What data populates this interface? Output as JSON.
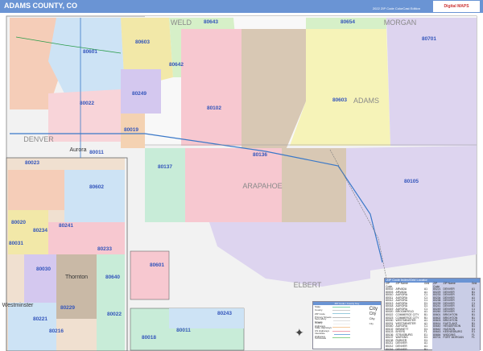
{
  "header": {
    "title": "ADAMS COUNTY, CO",
    "edition": "2022 ZIP Code ColorCast Edition",
    "logo": "Digital MAPS"
  },
  "counties": [
    "WELD",
    "MORGAN",
    "ADAMS",
    "ARAPAHOE",
    "ELBERT",
    "DENVER"
  ],
  "zip_labels": [
    "80643",
    "80654",
    "80701",
    "80603",
    "80601",
    "80642",
    "80249",
    "80022",
    "80102",
    "80603",
    "80019",
    "80011",
    "80136",
    "80023",
    "80137",
    "80602",
    "80105",
    "80020",
    "80241",
    "80234",
    "80031",
    "80233",
    "80601",
    "80640",
    "80030",
    "80229",
    "80221",
    "80216",
    "80022",
    "80243",
    "80011",
    "80018"
  ],
  "cities": [
    "Aurora",
    "Westminster",
    "Thornton"
  ],
  "zip_table": {
    "title": "ZIP Code Index/Grid Locator",
    "headers": [
      "ZIP Code",
      "ZIP Name",
      "Grid"
    ],
    "left": [
      [
        "80002",
        "ARVADA",
        "A1"
      ],
      [
        "80003",
        "ARVADA",
        "A1"
      ],
      [
        "80010",
        "AURORA",
        "C1"
      ],
      [
        "80011",
        "AURORA",
        "C1"
      ],
      [
        "80012",
        "AURORA",
        "C1"
      ],
      [
        "80013",
        "AURORA",
        "D1"
      ],
      [
        "80018",
        "AURORA",
        "D1"
      ],
      [
        "80019",
        "AURORA",
        "C1"
      ],
      [
        "80020",
        "BROOMFIELD",
        "A1"
      ],
      [
        "80022",
        "COMMERCE CITY",
        "B1"
      ],
      [
        "80023",
        "COMMERCE CITY",
        "B1"
      ],
      [
        "80030",
        "WESTMINSTER",
        "A1"
      ],
      [
        "80031",
        "WESTMINSTER",
        "A1"
      ],
      [
        "80040",
        "AURORA",
        "C1"
      ],
      [
        "80102",
        "BENNETT",
        "D1"
      ],
      [
        "80103",
        "BYERS",
        "F1"
      ],
      [
        "80136",
        "STRASBURG",
        "E1"
      ],
      [
        "80137",
        "WATKINS",
        "D1"
      ],
      [
        "80138",
        "PARKER",
        "D1"
      ],
      [
        "80211",
        "DENVER",
        "A1"
      ],
      [
        "80212",
        "DENVER",
        "A1"
      ],
      [
        "80216",
        "DENVER",
        "B1"
      ]
    ],
    "right": [
      [
        "80221",
        "DENVER",
        "A1"
      ],
      [
        "80229",
        "DENVER",
        "B1"
      ],
      [
        "80233",
        "DENVER",
        "B1"
      ],
      [
        "80234",
        "DENVER",
        "A1"
      ],
      [
        "80238",
        "DENVER",
        "C1"
      ],
      [
        "80239",
        "DENVER",
        "C1"
      ],
      [
        "80241",
        "DENVER",
        "B1"
      ],
      [
        "80249",
        "DENVER",
        "C1"
      ],
      [
        "80260",
        "DENVER",
        "A1"
      ],
      [
        "80601",
        "BRIGHTON",
        "B1"
      ],
      [
        "80602",
        "BRIGHTON",
        "B1"
      ],
      [
        "80603",
        "BRIGHTON",
        "C1"
      ],
      [
        "80614",
        "EASTLAKE",
        "B1"
      ],
      [
        "80640",
        "HENDERSON",
        "B1"
      ],
      [
        "80642",
        "HUDSON",
        "D1"
      ],
      [
        "80643",
        "KEENESBURG",
        "E1"
      ],
      [
        "80654",
        "WIGGINS",
        "F1"
      ],
      [
        "80701",
        "FORT MORGAN",
        "F1"
      ]
    ]
  },
  "legend": {
    "title": "ZIP Code / County Key",
    "items": [
      "State",
      "County",
      "ZIP Code",
      "Primary Streets",
      "Secondary Streets",
      "County Highways",
      "State Highways",
      "US Highways",
      "Interstate Highways",
      "Toll Roads"
    ],
    "city_sizes": [
      "City",
      "City",
      "City",
      "City"
    ]
  },
  "colors": {
    "header": "#6a94d4",
    "zip_label": "#3355bb"
  }
}
